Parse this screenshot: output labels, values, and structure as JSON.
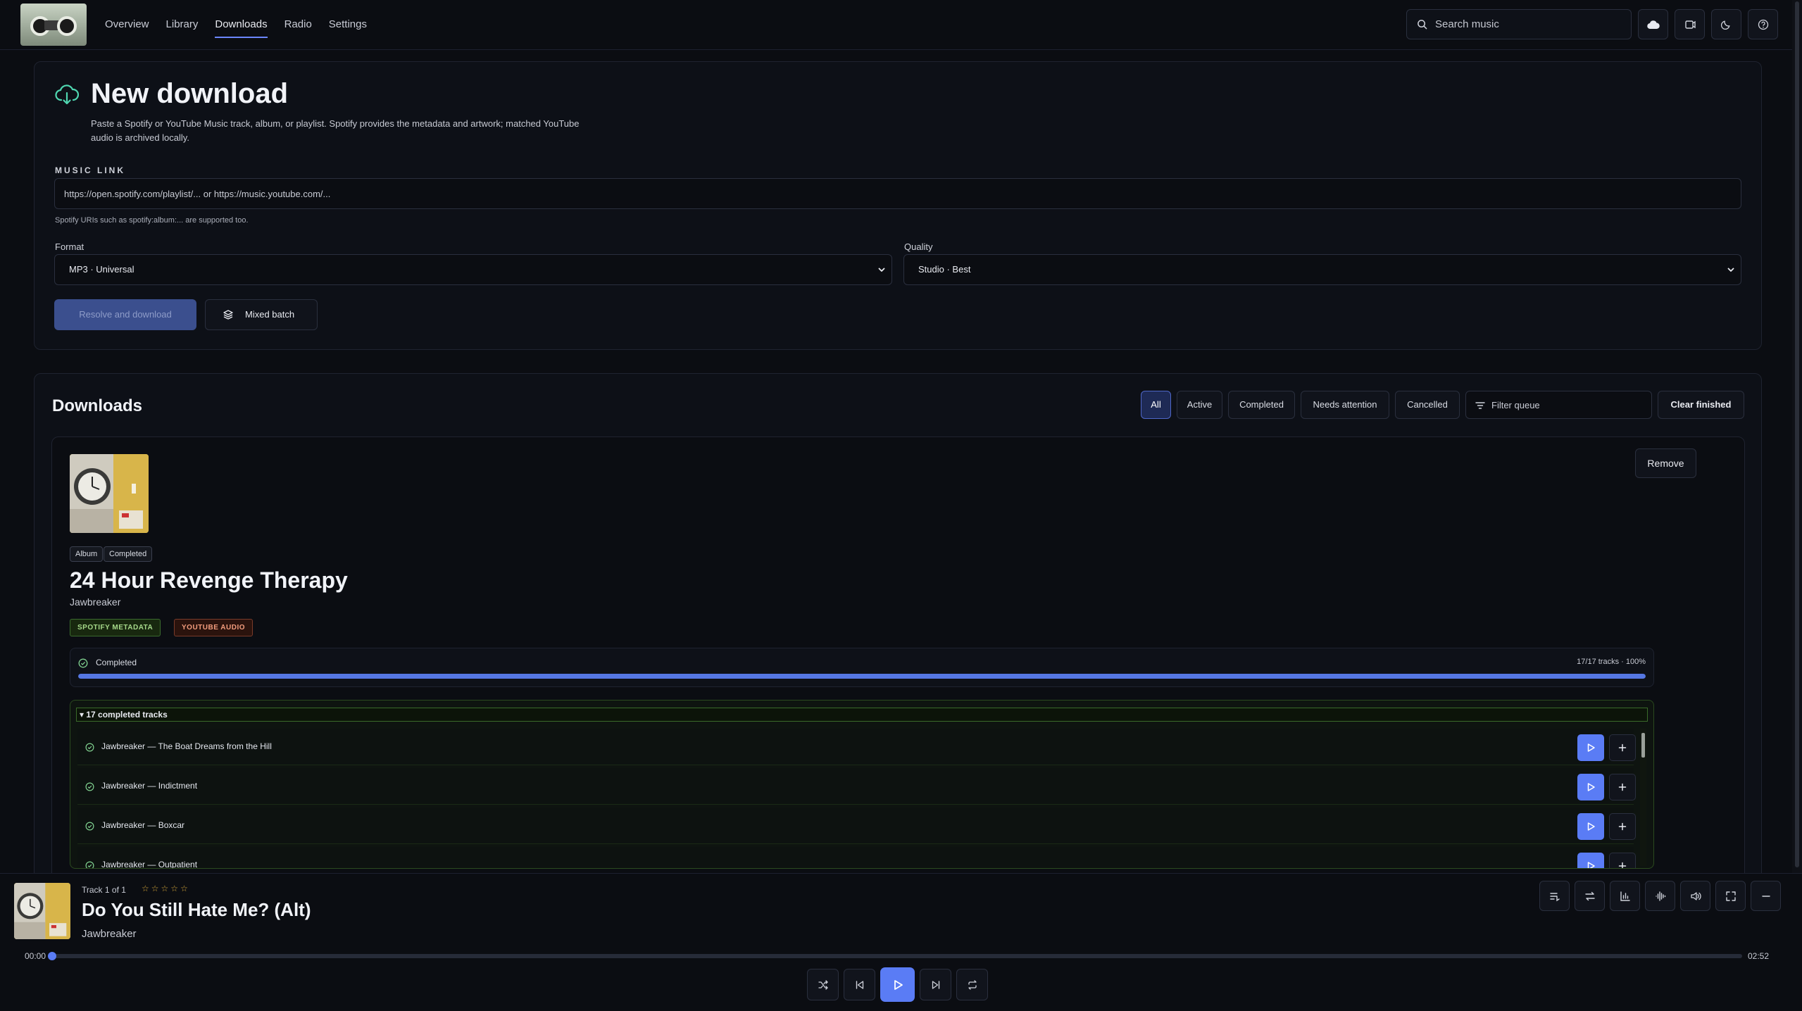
{
  "nav": {
    "items": [
      {
        "label": "Overview",
        "active": false
      },
      {
        "label": "Library",
        "active": false
      },
      {
        "label": "Downloads",
        "active": true
      },
      {
        "label": "Radio",
        "active": false
      },
      {
        "label": "Settings",
        "active": false
      }
    ],
    "search_placeholder": "Search music",
    "accent_color": "#6b86ff"
  },
  "new_download": {
    "title": "New download",
    "description": "Paste a Spotify or YouTube Music track, album, or playlist. Spotify provides the metadata and artwork; matched YouTube audio is archived locally.",
    "link_label": "MUSIC LINK",
    "link_placeholder": "https://open.spotify.com/playlist/... or https://music.youtube.com/...",
    "link_hint": "Spotify URIs such as spotify:album:... are supported too.",
    "format_label": "Format",
    "format_value": "MP3 · Universal",
    "quality_label": "Quality",
    "quality_value": "Studio · Best",
    "resolve_button": "Resolve and download",
    "batch_button": "Mixed batch"
  },
  "downloads": {
    "title": "Downloads",
    "filters": [
      "All",
      "Active",
      "Completed",
      "Needs attention",
      "Cancelled"
    ],
    "active_filter": "All",
    "filter_placeholder": "Filter queue",
    "clear_button": "Clear finished",
    "item": {
      "type_tag": "Album",
      "status_tag": "Completed",
      "title": "24 Hour Revenge Therapy",
      "artist": "Jawbreaker",
      "source_metadata": "SPOTIFY METADATA",
      "source_audio": "YOUTUBE AUDIO",
      "remove_button": "Remove",
      "progress_status": "Completed",
      "progress_detail": "17/17 tracks · 100%",
      "progress_fraction": 1.0,
      "tracks_header": "17 completed tracks",
      "tracks": [
        "Jawbreaker — The Boat Dreams from the Hill",
        "Jawbreaker — Indictment",
        "Jawbreaker — Boxcar",
        "Jawbreaker — Outpatient"
      ]
    }
  },
  "player": {
    "track_position": "Track 1 of 1",
    "rating": 0,
    "stars": [
      "☆",
      "☆",
      "☆",
      "☆",
      "☆"
    ],
    "title": "Do You Still Hate Me? (Alt)",
    "artist": "Jawbreaker",
    "elapsed": "00:00",
    "duration": "02:52",
    "progress_fraction": 0.0
  }
}
